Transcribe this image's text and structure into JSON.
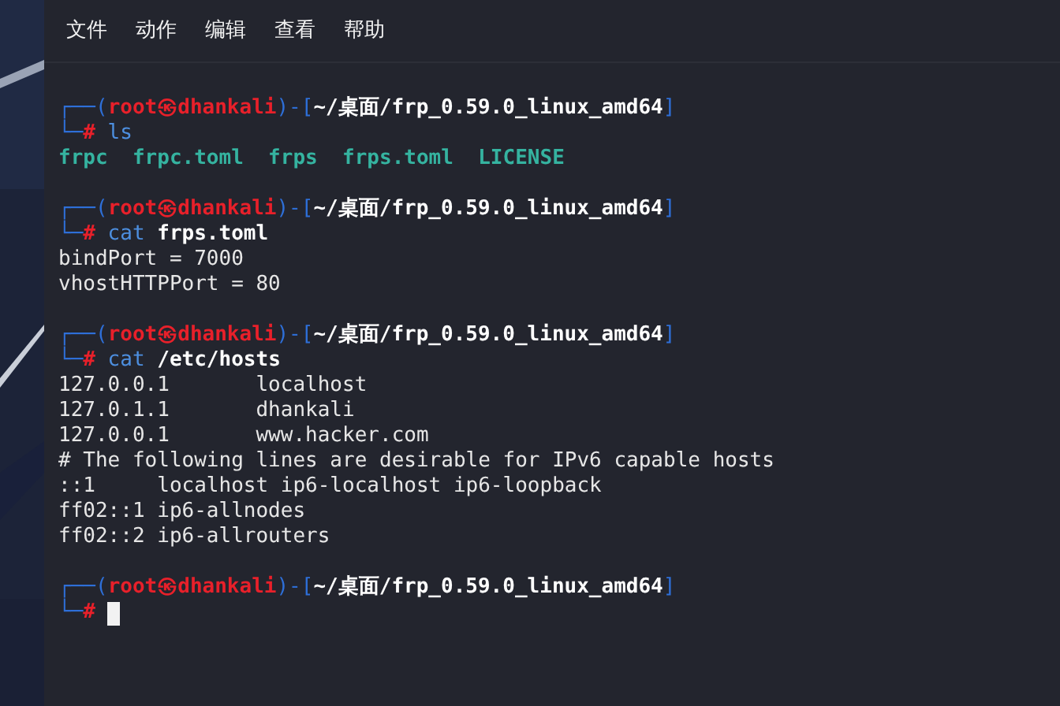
{
  "menu": [
    "文件",
    "动作",
    "编辑",
    "查看",
    "帮助"
  ],
  "lines": [
    {
      "kind": "blank"
    },
    {
      "kind": "prompt",
      "segments": [
        {
          "text": "┌──(",
          "kind": "frame"
        },
        {
          "text": "root㉿dhankali",
          "kind": "user"
        },
        {
          "text": ")-[",
          "kind": "frame"
        },
        {
          "text": "~/桌面/frp_0.59.0_linux_amd64",
          "kind": "path"
        },
        {
          "text": "]",
          "kind": "frame"
        }
      ]
    },
    {
      "kind": "prompt",
      "segments": [
        {
          "text": "└─",
          "kind": "frame"
        },
        {
          "text": "#",
          "kind": "user"
        },
        {
          "text": " ls",
          "kind": "command"
        }
      ]
    },
    {
      "kind": "output",
      "segments": [
        {
          "text": "frpc  frpc.toml  frps  frps.toml  LICENSE",
          "kind": "file"
        }
      ]
    },
    {
      "kind": "blank"
    },
    {
      "kind": "prompt",
      "segments": [
        {
          "text": "┌──(",
          "kind": "frame"
        },
        {
          "text": "root㉿dhankali",
          "kind": "user"
        },
        {
          "text": ")-[",
          "kind": "frame"
        },
        {
          "text": "~/桌面/frp_0.59.0_linux_amd64",
          "kind": "path"
        },
        {
          "text": "]",
          "kind": "frame"
        }
      ]
    },
    {
      "kind": "prompt",
      "segments": [
        {
          "text": "└─",
          "kind": "frame"
        },
        {
          "text": "#",
          "kind": "user"
        },
        {
          "text": " cat",
          "kind": "command"
        },
        {
          "text": " frps.toml",
          "kind": "argument"
        }
      ]
    },
    {
      "kind": "output",
      "segments": [
        {
          "text": "bindPort = 7000",
          "kind": "plain"
        }
      ]
    },
    {
      "kind": "output",
      "segments": [
        {
          "text": "vhostHTTPPort = 80",
          "kind": "plain"
        }
      ]
    },
    {
      "kind": "blank"
    },
    {
      "kind": "prompt",
      "segments": [
        {
          "text": "┌──(",
          "kind": "frame"
        },
        {
          "text": "root㉿dhankali",
          "kind": "user"
        },
        {
          "text": ")-[",
          "kind": "frame"
        },
        {
          "text": "~/桌面/frp_0.59.0_linux_amd64",
          "kind": "path"
        },
        {
          "text": "]",
          "kind": "frame"
        }
      ]
    },
    {
      "kind": "prompt",
      "segments": [
        {
          "text": "└─",
          "kind": "frame"
        },
        {
          "text": "#",
          "kind": "user"
        },
        {
          "text": " cat",
          "kind": "command"
        },
        {
          "text": " /etc/hosts",
          "kind": "argument"
        }
      ]
    },
    {
      "kind": "output",
      "segments": [
        {
          "text": "127.0.0.1       localhost",
          "kind": "plain"
        }
      ]
    },
    {
      "kind": "output",
      "segments": [
        {
          "text": "127.0.1.1       dhankali",
          "kind": "plain"
        }
      ]
    },
    {
      "kind": "output",
      "segments": [
        {
          "text": "127.0.0.1       www.hacker.com",
          "kind": "plain"
        }
      ]
    },
    {
      "kind": "output",
      "segments": [
        {
          "text": "# The following lines are desirable for IPv6 capable hosts",
          "kind": "plain"
        }
      ]
    },
    {
      "kind": "output",
      "segments": [
        {
          "text": "::1     localhost ip6-localhost ip6-loopback",
          "kind": "plain"
        }
      ]
    },
    {
      "kind": "output",
      "segments": [
        {
          "text": "ff02::1 ip6-allnodes",
          "kind": "plain"
        }
      ]
    },
    {
      "kind": "output",
      "segments": [
        {
          "text": "ff02::2 ip6-allrouters",
          "kind": "plain"
        }
      ]
    },
    {
      "kind": "blank"
    },
    {
      "kind": "prompt",
      "segments": [
        {
          "text": "┌──(",
          "kind": "frame"
        },
        {
          "text": "root㉿dhankali",
          "kind": "user"
        },
        {
          "text": ")-[",
          "kind": "frame"
        },
        {
          "text": "~/桌面/frp_0.59.0_linux_amd64",
          "kind": "path"
        },
        {
          "text": "]",
          "kind": "frame"
        }
      ]
    },
    {
      "kind": "input",
      "segments": [
        {
          "text": "└─",
          "kind": "frame"
        },
        {
          "text": "#",
          "kind": "user"
        }
      ]
    }
  ]
}
